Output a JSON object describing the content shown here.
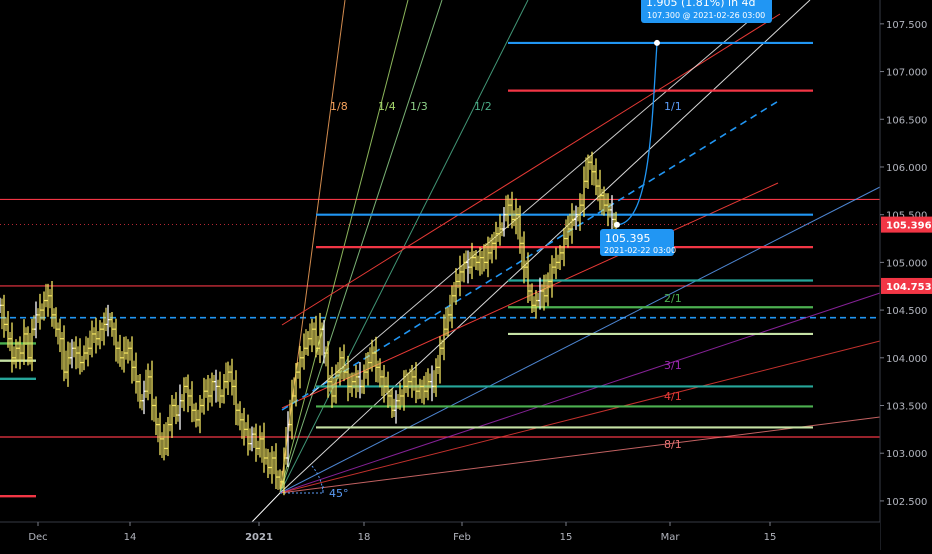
{
  "chart_data": {
    "type": "ohlc",
    "symbol_context": "price chart with Gann fan, trend lines and projection",
    "y_axis": {
      "min": 102.3,
      "max": 107.75,
      "ticks": [
        "102.500",
        "103.000",
        "103.500",
        "104.000",
        "104.500",
        "105.000",
        "105.500",
        "106.000",
        "106.500",
        "107.000",
        "107.500"
      ],
      "price_badges": [
        {
          "value": "105.396",
          "color": "#f23645"
        },
        {
          "value": "104.753",
          "color": "#f23645"
        }
      ]
    },
    "x_axis": {
      "ticks": [
        "Dec",
        "14",
        "2021",
        "18",
        "Feb",
        "15",
        "Mar",
        "15"
      ]
    },
    "gann_fan": {
      "angle_label": "45°",
      "labels": [
        "1/8",
        "1/4",
        "1/3",
        "1/2",
        "1/1",
        "2/1",
        "3/1",
        "4/1",
        "8/1"
      ],
      "label_colors": [
        "#f7a35c",
        "#a5d66b",
        "#8fd18a",
        "#4caf8a",
        "#5b9cf6",
        "#4caf50",
        "#9c27b0",
        "#e53935",
        "#e57373"
      ]
    },
    "horizontal_levels": [
      {
        "price": 107.3,
        "color": "#2196f3"
      },
      {
        "price": 106.8,
        "color": "#f23645"
      },
      {
        "price": 105.5,
        "color": "#2196f3"
      },
      {
        "price": 105.16,
        "color": "#f23645"
      },
      {
        "price": 104.81,
        "color": "#26a69a"
      },
      {
        "price": 104.53,
        "color": "#4caf50"
      },
      {
        "price": 104.25,
        "color": "#c5e1a5"
      },
      {
        "price": 103.7,
        "color": "#26a69a"
      },
      {
        "price": 103.49,
        "color": "#4caf50"
      },
      {
        "price": 103.27,
        "color": "#c5e1a5"
      }
    ],
    "long_levels": [
      {
        "price": 105.66,
        "color": "#f23645",
        "style": "solid"
      },
      {
        "price": 104.753,
        "color": "#f23645",
        "style": "solid"
      },
      {
        "price": 104.42,
        "color": "#2196f3",
        "style": "dashed"
      },
      {
        "price": 103.17,
        "color": "#f23645",
        "style": "solid"
      }
    ],
    "last_price": 105.396,
    "projection": {
      "from": {
        "price": "105.395",
        "time": "2021-02-22 03:00"
      },
      "to": {
        "price": "107.300",
        "time": "2021-02-26  03:00"
      },
      "change_text": "1.905 (1.81%) in 4d",
      "to_text": "107.300 @ 2021-02-26  03:00"
    },
    "bars_close_path": [
      [
        0,
        104.55
      ],
      [
        4,
        104.35
      ],
      [
        8,
        104.2
      ],
      [
        12,
        104.0
      ],
      [
        16,
        104.1
      ],
      [
        20,
        104.05
      ],
      [
        24,
        104.25
      ],
      [
        28,
        104.0
      ],
      [
        32,
        104.3
      ],
      [
        36,
        104.45
      ],
      [
        40,
        104.5
      ],
      [
        44,
        104.6
      ],
      [
        48,
        104.65
      ],
      [
        52,
        104.45
      ],
      [
        56,
        104.3
      ],
      [
        60,
        104.2
      ],
      [
        64,
        103.85
      ],
      [
        68,
        104.0
      ],
      [
        72,
        104.1
      ],
      [
        76,
        104.05
      ],
      [
        80,
        103.95
      ],
      [
        84,
        104.05
      ],
      [
        88,
        104.1
      ],
      [
        92,
        104.25
      ],
      [
        96,
        104.2
      ],
      [
        100,
        104.3
      ],
      [
        104,
        104.35
      ],
      [
        108,
        104.4
      ],
      [
        112,
        104.3
      ],
      [
        116,
        104.1
      ],
      [
        120,
        104.0
      ],
      [
        124,
        104.05
      ],
      [
        128,
        104.1
      ],
      [
        132,
        103.9
      ],
      [
        136,
        103.75
      ],
      [
        140,
        103.55
      ],
      [
        144,
        103.65
      ],
      [
        148,
        103.8
      ],
      [
        152,
        103.5
      ],
      [
        156,
        103.3
      ],
      [
        160,
        103.15
      ],
      [
        164,
        103.05
      ],
      [
        168,
        103.3
      ],
      [
        172,
        103.5
      ],
      [
        176,
        103.4
      ],
      [
        180,
        103.55
      ],
      [
        184,
        103.7
      ],
      [
        188,
        103.6
      ],
      [
        192,
        103.45
      ],
      [
        196,
        103.35
      ],
      [
        200,
        103.5
      ],
      [
        204,
        103.65
      ],
      [
        208,
        103.6
      ],
      [
        212,
        103.75
      ],
      [
        216,
        103.7
      ],
      [
        220,
        103.6
      ],
      [
        224,
        103.75
      ],
      [
        228,
        103.85
      ],
      [
        232,
        103.7
      ],
      [
        236,
        103.45
      ],
      [
        240,
        103.35
      ],
      [
        244,
        103.25
      ],
      [
        248,
        103.1
      ],
      [
        252,
        103.2
      ],
      [
        256,
        103.05
      ],
      [
        260,
        103.15
      ],
      [
        264,
        102.95
      ],
      [
        268,
        102.85
      ],
      [
        272,
        102.95
      ],
      [
        276,
        102.75
      ],
      [
        280,
        102.7
      ],
      [
        284,
        102.95
      ],
      [
        288,
        103.3
      ],
      [
        292,
        103.6
      ],
      [
        296,
        103.85
      ],
      [
        300,
        104.0
      ],
      [
        304,
        104.1
      ],
      [
        308,
        104.2
      ],
      [
        312,
        104.3
      ],
      [
        316,
        104.1
      ],
      [
        320,
        104.3
      ],
      [
        324,
        104.05
      ],
      [
        328,
        103.75
      ],
      [
        332,
        103.6
      ],
      [
        336,
        103.85
      ],
      [
        340,
        104.0
      ],
      [
        344,
        103.85
      ],
      [
        348,
        103.7
      ],
      [
        352,
        103.75
      ],
      [
        356,
        103.8
      ],
      [
        360,
        103.7
      ],
      [
        364,
        103.85
      ],
      [
        368,
        103.95
      ],
      [
        372,
        104.05
      ],
      [
        376,
        103.9
      ],
      [
        380,
        103.8
      ],
      [
        384,
        103.7
      ],
      [
        388,
        103.6
      ],
      [
        392,
        103.45
      ],
      [
        396,
        103.55
      ],
      [
        400,
        103.6
      ],
      [
        404,
        103.7
      ],
      [
        408,
        103.75
      ],
      [
        412,
        103.8
      ],
      [
        416,
        103.65
      ],
      [
        420,
        103.7
      ],
      [
        424,
        103.65
      ],
      [
        428,
        103.75
      ],
      [
        432,
        103.7
      ],
      [
        436,
        103.9
      ],
      [
        440,
        104.1
      ],
      [
        444,
        104.3
      ],
      [
        448,
        104.45
      ],
      [
        452,
        104.65
      ],
      [
        456,
        104.8
      ],
      [
        460,
        104.9
      ],
      [
        464,
        105.0
      ],
      [
        468,
        104.95
      ],
      [
        472,
        105.05
      ],
      [
        476,
        105.0
      ],
      [
        480,
        105.05
      ],
      [
        484,
        105.0
      ],
      [
        488,
        105.1
      ],
      [
        492,
        105.2
      ],
      [
        496,
        105.3
      ],
      [
        500,
        105.35
      ],
      [
        504,
        105.5
      ],
      [
        508,
        105.6
      ],
      [
        512,
        105.45
      ],
      [
        516,
        105.5
      ],
      [
        520,
        105.2
      ],
      [
        524,
        104.95
      ],
      [
        528,
        104.7
      ],
      [
        532,
        104.55
      ],
      [
        536,
        104.6
      ],
      [
        540,
        104.7
      ],
      [
        544,
        104.65
      ],
      [
        548,
        104.8
      ],
      [
        552,
        104.95
      ],
      [
        556,
        105.0
      ],
      [
        560,
        105.1
      ],
      [
        564,
        105.25
      ],
      [
        568,
        105.35
      ],
      [
        572,
        105.45
      ],
      [
        576,
        105.5
      ],
      [
        580,
        105.6
      ],
      [
        584,
        105.85
      ],
      [
        588,
        106.05
      ],
      [
        592,
        105.95
      ],
      [
        596,
        105.8
      ],
      [
        600,
        105.7
      ],
      [
        604,
        105.6
      ],
      [
        608,
        105.55
      ],
      [
        612,
        105.45
      ],
      [
        616,
        105.4
      ]
    ]
  }
}
